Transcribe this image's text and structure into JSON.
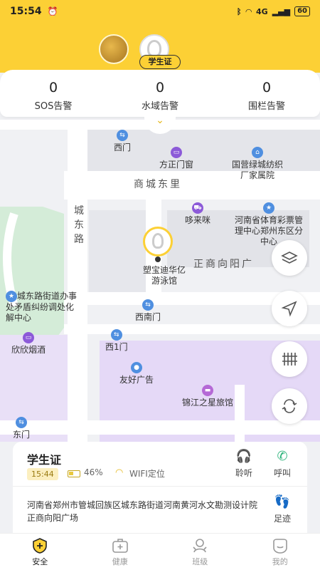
{
  "status_bar": {
    "time": "15:54",
    "signal": "4G",
    "battery": "60"
  },
  "header": {
    "student_tag": "学生证"
  },
  "alerts": [
    {
      "count": "0",
      "label": "SOS告警"
    },
    {
      "count": "0",
      "label": "水域告警"
    },
    {
      "count": "0",
      "label": "围栏告警"
    }
  ],
  "map": {
    "pois": {
      "xi_men": "西门",
      "fang_zheng": "方正门窗",
      "guoying": "国营绿城纺织厂家属院",
      "shangcheng_dongli": "商城东里",
      "chengdong_lu": "城东路",
      "duolaimi": "哆来咪",
      "tiyu": "河南省体育彩票管理中心郑州东区分中心",
      "zhengshang": "正商向阳广",
      "youyong": "塑宝迪华亿游泳馆",
      "jiedao": "城东路街道办事处矛盾纠纷调处化解中心",
      "xinan_men": "西南门",
      "xinxin": "欣欣烟酒",
      "xi1_men": "西1门",
      "youhao": "友好广告",
      "jinjiang": "锦江之星旅馆",
      "dong_men": "东门"
    }
  },
  "card": {
    "title": "学生证",
    "time": "15:44",
    "battery_pct": "46%",
    "battery_level": 0.46,
    "location_mode": "WIFI定位",
    "listen_label": "聆听",
    "call_label": "呼叫",
    "track_label": "足迹",
    "address": "河南省郑州市管城回族区城东路街道河南黄河水文勘测设计院正商向阳广场"
  },
  "nav": [
    {
      "label": "安全",
      "icon": "shield-plus-icon",
      "active": true
    },
    {
      "label": "健康",
      "icon": "medkit-icon",
      "active": false
    },
    {
      "label": "班级",
      "icon": "class-icon",
      "active": false
    },
    {
      "label": "我的",
      "icon": "profile-icon",
      "active": false
    }
  ],
  "colors": {
    "accent": "#fcd035",
    "map_green": "#d4ecd8",
    "map_purple": "#e5d9f7"
  }
}
